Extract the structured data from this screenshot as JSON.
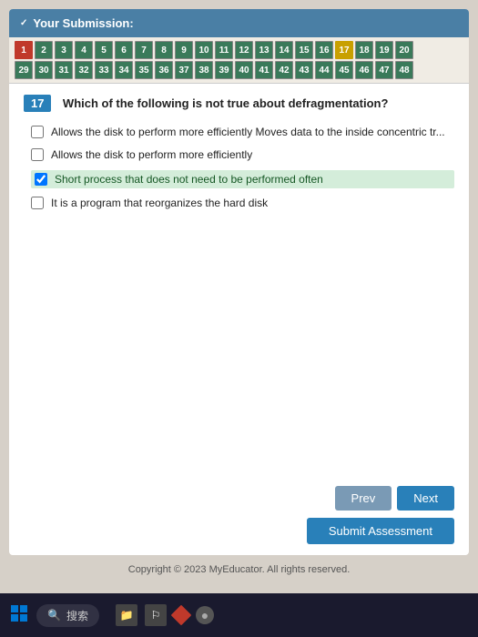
{
  "header": {
    "title": "Your Submission:"
  },
  "number_grid": {
    "row1": [
      1,
      2,
      3,
      4,
      5,
      6,
      7,
      8,
      9,
      10,
      11,
      12,
      13,
      14,
      15,
      16,
      17,
      18,
      19,
      20
    ],
    "row2": [
      29,
      30,
      31,
      32,
      33,
      34,
      35,
      36,
      37,
      38,
      39,
      40,
      41,
      42,
      43,
      44,
      45,
      46,
      47,
      48
    ]
  },
  "question": {
    "number": "17",
    "text": "Which of the following is not true about defragmentation?",
    "options": [
      {
        "id": "opt1",
        "text": "Allows the disk to perform more efficiently Moves data to the inside concentric tr...",
        "checked": false
      },
      {
        "id": "opt2",
        "text": "Allows the disk to perform more efficiently",
        "checked": false
      },
      {
        "id": "opt3",
        "text": "Short process that does not need to be performed often",
        "checked": true
      },
      {
        "id": "opt4",
        "text": "It is a program that reorganizes the hard disk",
        "checked": false
      }
    ]
  },
  "buttons": {
    "prev_label": "Prev",
    "next_label": "Next",
    "submit_label": "Submit Assessment"
  },
  "copyright": "Copyright © 2023 MyEducator. All rights reserved.",
  "taskbar": {
    "search_text": "搜索"
  }
}
